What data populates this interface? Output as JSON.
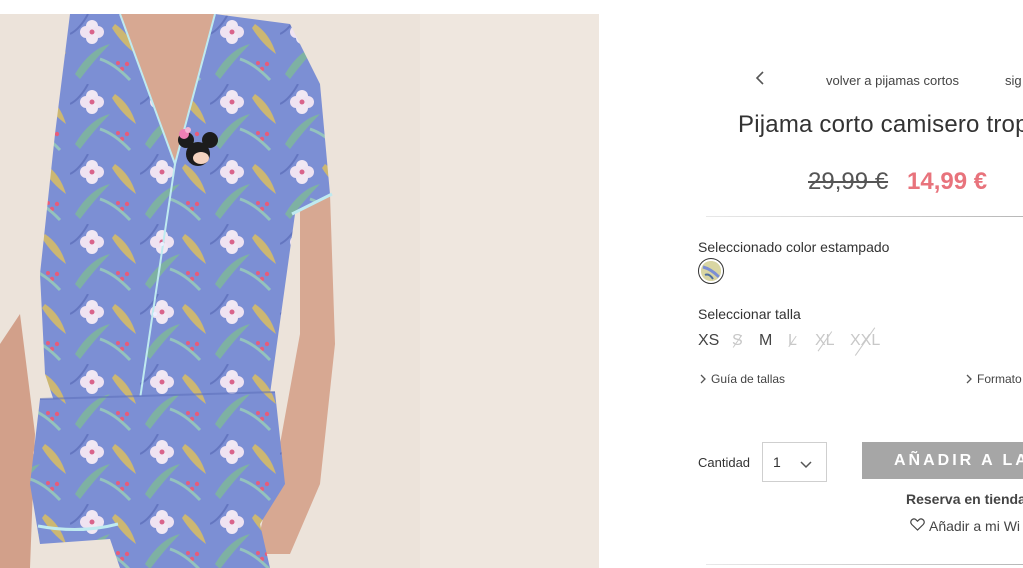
{
  "product_image": {
    "alt": "Pijama corto camisero tropical",
    "colors": {
      "background": "#ece3da",
      "fabric": "#7c8fd4",
      "skin": "#d7a892",
      "piping": "#bfeaf0"
    }
  },
  "nav": {
    "prev_icon": "chevron-left-icon",
    "back_label": "volver a pijamas cortos",
    "next_label": "sig"
  },
  "product": {
    "title": "Pijama corto camisero trop",
    "price_old": "29,99 €",
    "price_new": "14,99 €",
    "price_new_color": "#e8737c"
  },
  "color_section": {
    "label": "Seleccionado color estampado",
    "swatch_icon": "print-swatch-icon"
  },
  "size_section": {
    "label": "Seleccionar talla",
    "sizes": [
      {
        "label": "XS",
        "available": true
      },
      {
        "label": "S",
        "available": false
      },
      {
        "label": "M",
        "available": true
      },
      {
        "label": "L",
        "available": false
      },
      {
        "label": "XL",
        "available": false
      },
      {
        "label": "XXL",
        "available": false
      }
    ]
  },
  "links": {
    "size_guide": "Guía de tallas",
    "format": "Formato"
  },
  "purchase": {
    "quantity_label": "Cantidad",
    "quantity_value": "1",
    "add_button": "AÑADIR A LA B",
    "add_button_color": "#a6a6a6",
    "reserve_label": "Reserva en tienda",
    "wishlist_label": "Añadir a mi Wi",
    "wishlist_icon": "heart-icon"
  }
}
